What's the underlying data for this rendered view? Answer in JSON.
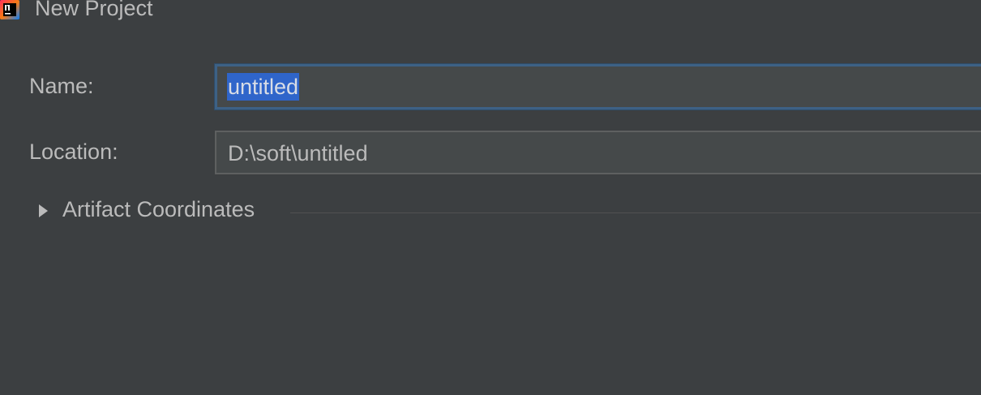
{
  "window": {
    "title": "New Project",
    "app_icon": "intellij-idea-icon"
  },
  "form": {
    "name_label": "Name:",
    "name_value": "untitled",
    "location_label": "Location:",
    "location_value": "D:\\soft\\untitled"
  },
  "sections": {
    "artifact_coordinates": {
      "label": "Artifact Coordinates",
      "icon": "chevron-right-icon",
      "expanded": false
    }
  },
  "colors": {
    "background": "#3c3f41",
    "input_background": "#45494a",
    "focus_border": "#3d6185",
    "selection": "#2f65ca",
    "text": "#bbbbbb"
  }
}
